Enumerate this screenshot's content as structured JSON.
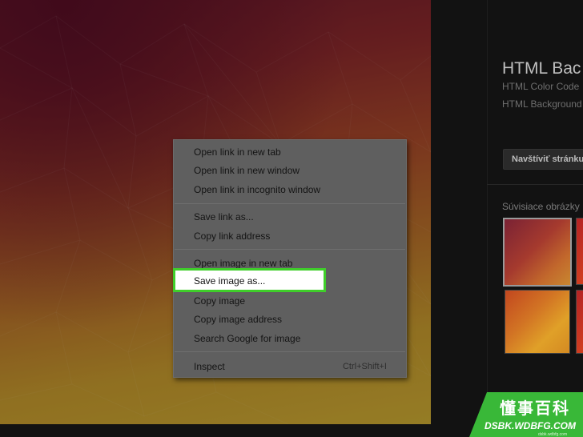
{
  "side_panel": {
    "title": "HTML Bac",
    "subtitle_1": "HTML Color Code",
    "subtitle_2": "HTML Background",
    "visit_button": "Navštíviť stránku",
    "related_label": "Súvisiace obrázky"
  },
  "context_menu": {
    "items": [
      {
        "label": "Open link in new tab"
      },
      {
        "label": "Open link in new window"
      },
      {
        "label": "Open link in incognito window"
      },
      {
        "label": "Save link as..."
      },
      {
        "label": "Copy link address"
      },
      {
        "label": "Open image in new tab"
      },
      {
        "label": "Save image as..."
      },
      {
        "label": "Copy image"
      },
      {
        "label": "Copy image address"
      },
      {
        "label": "Search Google for image"
      },
      {
        "label": "Inspect",
        "shortcut": "Ctrl+Shift+I"
      }
    ],
    "highlighted_index": 6
  },
  "colors": {
    "highlight_border": "#3fce2a",
    "watermark_green": "#39b838"
  },
  "watermark": {
    "chinese": "懂事百科",
    "domain": "DSBK.WDBFG.COM",
    "small": "dsbk.wdbfg.com"
  }
}
